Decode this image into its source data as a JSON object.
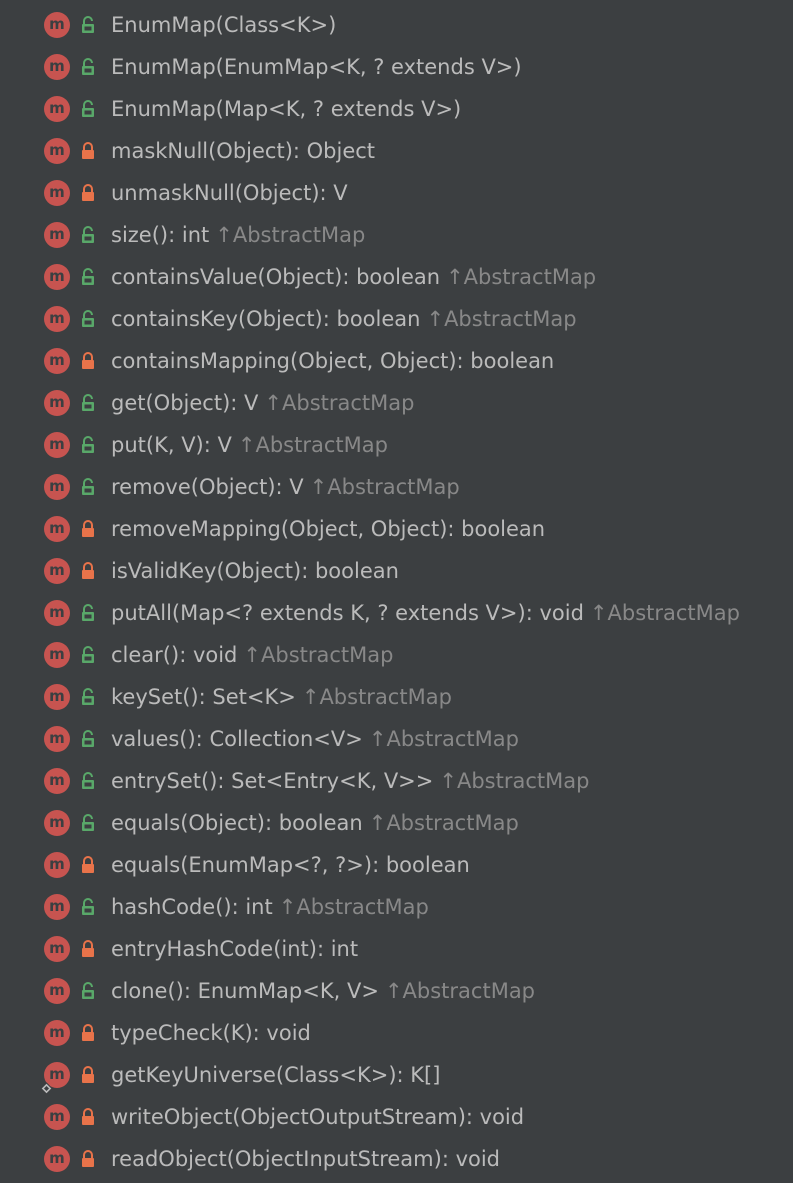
{
  "colors": {
    "background": "#3c3f41",
    "text": "#bbbbbb",
    "inherited_text": "#888888",
    "method_badge": "#c75450",
    "public_icon": "#59a869",
    "private_icon": "#e8734a"
  },
  "inherited_arrow": "↑",
  "members": [
    {
      "badge": "m",
      "access": "public",
      "signature": "EnumMap(Class<K>)",
      "inherited": ""
    },
    {
      "badge": "m",
      "access": "public",
      "signature": "EnumMap(EnumMap<K, ? extends V>)",
      "inherited": ""
    },
    {
      "badge": "m",
      "access": "public",
      "signature": "EnumMap(Map<K, ? extends V>)",
      "inherited": ""
    },
    {
      "badge": "m",
      "access": "private",
      "signature": "maskNull(Object): Object",
      "inherited": ""
    },
    {
      "badge": "m",
      "access": "private",
      "signature": "unmaskNull(Object): V",
      "inherited": ""
    },
    {
      "badge": "m",
      "access": "public",
      "signature": "size(): int",
      "inherited": "AbstractMap"
    },
    {
      "badge": "m",
      "access": "public",
      "signature": "containsValue(Object): boolean",
      "inherited": "AbstractMap"
    },
    {
      "badge": "m",
      "access": "public",
      "signature": "containsKey(Object): boolean",
      "inherited": "AbstractMap"
    },
    {
      "badge": "m",
      "access": "private",
      "signature": "containsMapping(Object, Object): boolean",
      "inherited": ""
    },
    {
      "badge": "m",
      "access": "public",
      "signature": "get(Object): V",
      "inherited": "AbstractMap"
    },
    {
      "badge": "m",
      "access": "public",
      "signature": "put(K, V): V",
      "inherited": "AbstractMap"
    },
    {
      "badge": "m",
      "access": "public",
      "signature": "remove(Object): V",
      "inherited": "AbstractMap"
    },
    {
      "badge": "m",
      "access": "private",
      "signature": "removeMapping(Object, Object): boolean",
      "inherited": ""
    },
    {
      "badge": "m",
      "access": "private",
      "signature": "isValidKey(Object): boolean",
      "inherited": ""
    },
    {
      "badge": "m",
      "access": "public",
      "signature": "putAll(Map<? extends K, ? extends V>): void",
      "inherited": "AbstractMap"
    },
    {
      "badge": "m",
      "access": "public",
      "signature": "clear(): void",
      "inherited": "AbstractMap"
    },
    {
      "badge": "m",
      "access": "public",
      "signature": "keySet(): Set<K>",
      "inherited": "AbstractMap"
    },
    {
      "badge": "m",
      "access": "public",
      "signature": "values(): Collection<V>",
      "inherited": "AbstractMap"
    },
    {
      "badge": "m",
      "access": "public",
      "signature": "entrySet(): Set<Entry<K, V>>",
      "inherited": "AbstractMap"
    },
    {
      "badge": "m",
      "access": "public",
      "signature": "equals(Object): boolean",
      "inherited": "AbstractMap"
    },
    {
      "badge": "m",
      "access": "private",
      "signature": "equals(EnumMap<?, ?>): boolean",
      "inherited": ""
    },
    {
      "badge": "m",
      "access": "public",
      "signature": "hashCode(): int",
      "inherited": "AbstractMap"
    },
    {
      "badge": "m",
      "access": "private",
      "signature": "entryHashCode(int): int",
      "inherited": ""
    },
    {
      "badge": "m",
      "access": "public",
      "signature": "clone(): EnumMap<K, V>",
      "inherited": "AbstractMap"
    },
    {
      "badge": "m",
      "access": "private",
      "signature": "typeCheck(K): void",
      "inherited": ""
    },
    {
      "badge": "m",
      "access": "private",
      "signature": "getKeyUniverse(Class<K>): K[]",
      "inherited": "",
      "static_mark": true
    },
    {
      "badge": "m",
      "access": "private",
      "signature": "writeObject(ObjectOutputStream): void",
      "inherited": ""
    },
    {
      "badge": "m",
      "access": "private",
      "signature": "readObject(ObjectInputStream): void",
      "inherited": ""
    }
  ]
}
